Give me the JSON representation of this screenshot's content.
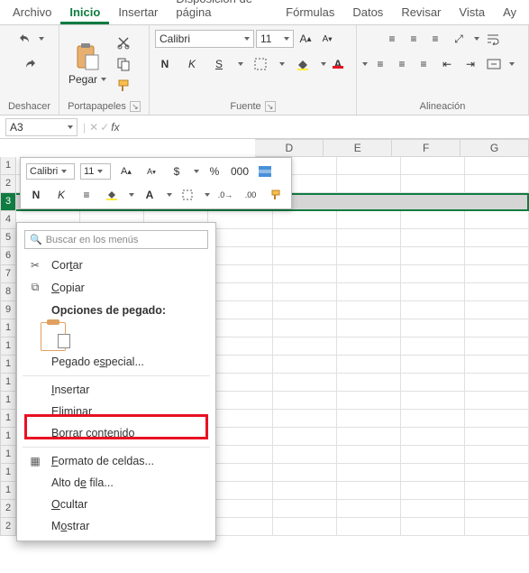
{
  "tabs": {
    "file": "Archivo",
    "home": "Inicio",
    "insert": "Insertar",
    "layout": "Disposición de página",
    "formulas": "Fórmulas",
    "data": "Datos",
    "review": "Revisar",
    "view": "Vista",
    "help": "Ay"
  },
  "ribbon": {
    "undo_group": "Deshacer",
    "clipboard_group": "Portapapeles",
    "paste_label": "Pegar",
    "font_group": "Fuente",
    "font_name": "Calibri",
    "font_size": "11",
    "bold": "N",
    "italic": "K",
    "underline": "S",
    "align_group": "Alineación"
  },
  "namebox": {
    "value": "A3"
  },
  "sheet": {
    "cols": [
      "D",
      "E",
      "F",
      "G"
    ],
    "rows": [
      "1",
      "2",
      "3",
      "4",
      "5",
      "6",
      "7",
      "8",
      "9",
      "1",
      "1",
      "1",
      "1",
      "1",
      "1",
      "1",
      "1",
      "1",
      "1",
      "2",
      "2"
    ]
  },
  "mini": {
    "font_name": "Calibri",
    "font_size": "11",
    "bold": "N",
    "italic": "K",
    "percent": "%",
    "currency": "$",
    "thousands": "000"
  },
  "ctx": {
    "search_placeholder": "Buscar en los menús",
    "cut": "Cortar",
    "copy": "Copiar",
    "paste_opts": "Opciones de pegado:",
    "paste_special": "Pegado especial...",
    "insert": "Insertar",
    "delete": "Eliminar",
    "clear": "Borrar contenido",
    "format_cells": "Formato de celdas...",
    "row_height": "Alto de fila...",
    "hide": "Ocultar",
    "show": "Mostrar"
  }
}
